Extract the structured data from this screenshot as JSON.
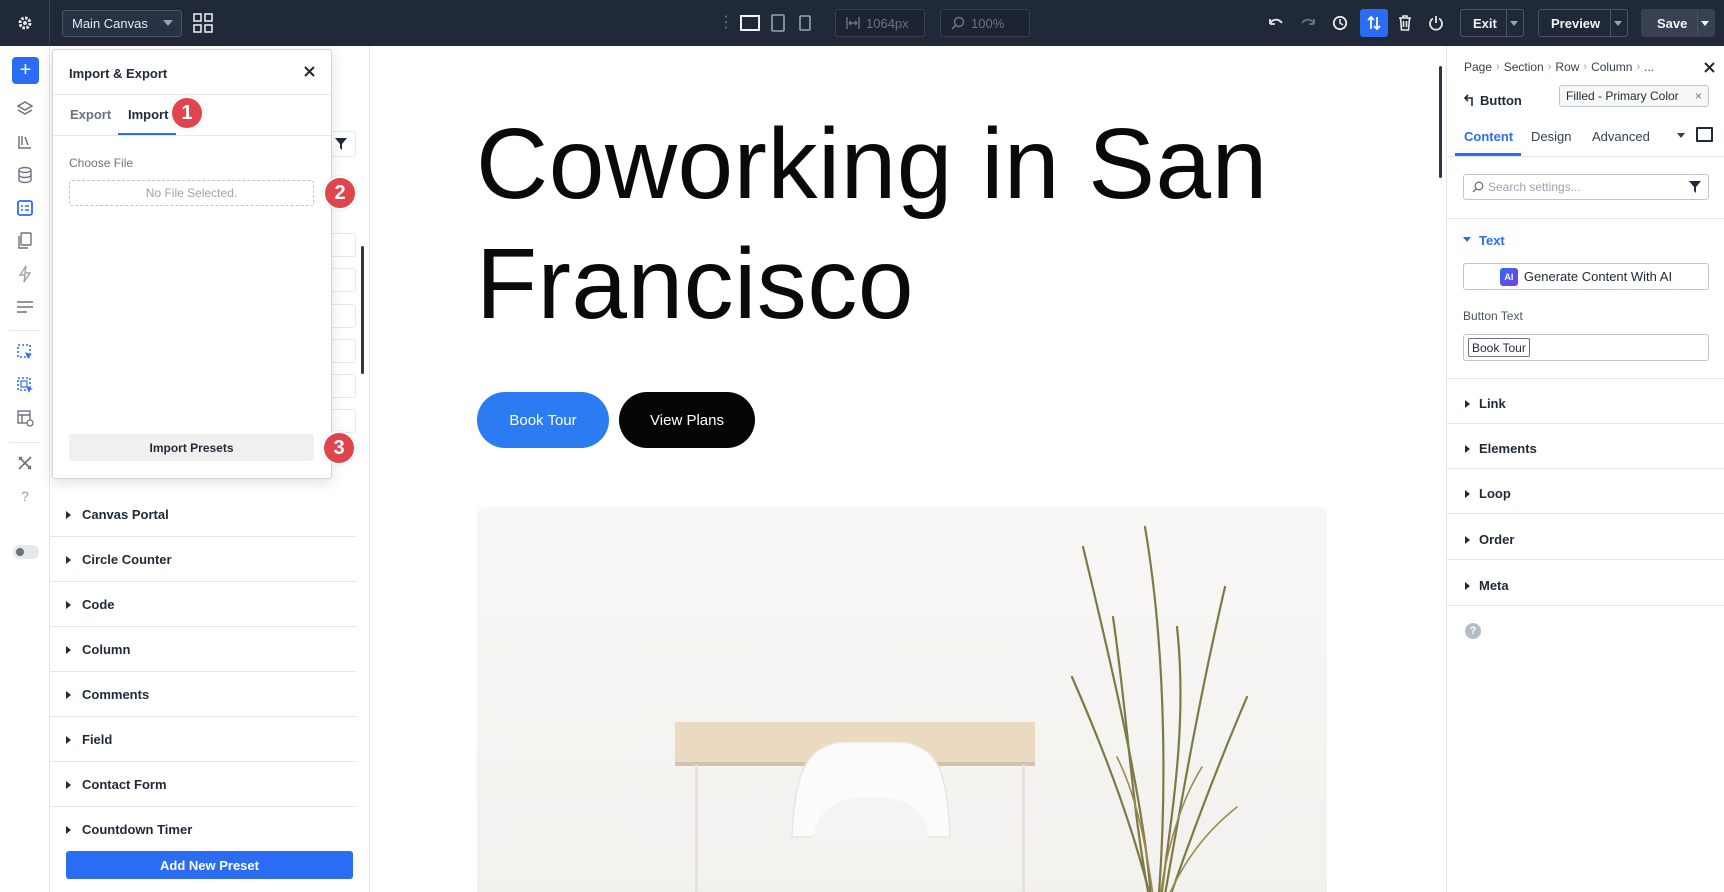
{
  "topbar": {
    "canvas_select": "Main Canvas",
    "width_value": "1064px",
    "zoom_value": "100%",
    "exit_label": "Exit",
    "preview_label": "Preview",
    "save_label": "Save",
    "icons": [
      "gear-icon",
      "grid-icon",
      "desktop-icon",
      "tablet-icon",
      "phone-icon",
      "undo-icon",
      "redo-icon",
      "history-icon",
      "sort-icon",
      "trash-icon",
      "power-icon"
    ],
    "accent": "#2b6cf5"
  },
  "presets_panel": {
    "items": [
      "Canvas Portal",
      "Circle Counter",
      "Code",
      "Column",
      "Comments",
      "Field",
      "Contact Form",
      "Countdown Timer"
    ],
    "add_label": "Add New Preset"
  },
  "import_export": {
    "title": "Import & Export",
    "tabs": [
      "Export",
      "Import"
    ],
    "active_tab": "Import",
    "choose_label": "Choose File",
    "file_placeholder": "No File Selected.",
    "import_label": "Import Presets",
    "steps": [
      "1",
      "2",
      "3"
    ],
    "step_color": "#e0454b"
  },
  "canvas": {
    "hero_title": "Coworking in San Francisco",
    "btn_primary": "Book Tour",
    "btn_secondary": "View Plans",
    "primary_color": "#2b7cf3"
  },
  "settings": {
    "breadcrumb": [
      "Page",
      "Section",
      "Row",
      "Column",
      "..."
    ],
    "module": "Button",
    "preset": "Filled - Primary Color",
    "tabs": [
      "Content",
      "Design",
      "Advanced"
    ],
    "active_tab": "Content",
    "search_placeholder": "Search settings...",
    "text_group": "Text",
    "ai_label": "Generate Content With AI",
    "ai_badge": "AI",
    "button_text_label": "Button Text",
    "button_text_value": "Book Tour",
    "groups": [
      "Link",
      "Elements",
      "Loop",
      "Order",
      "Meta"
    ],
    "help": "?"
  }
}
